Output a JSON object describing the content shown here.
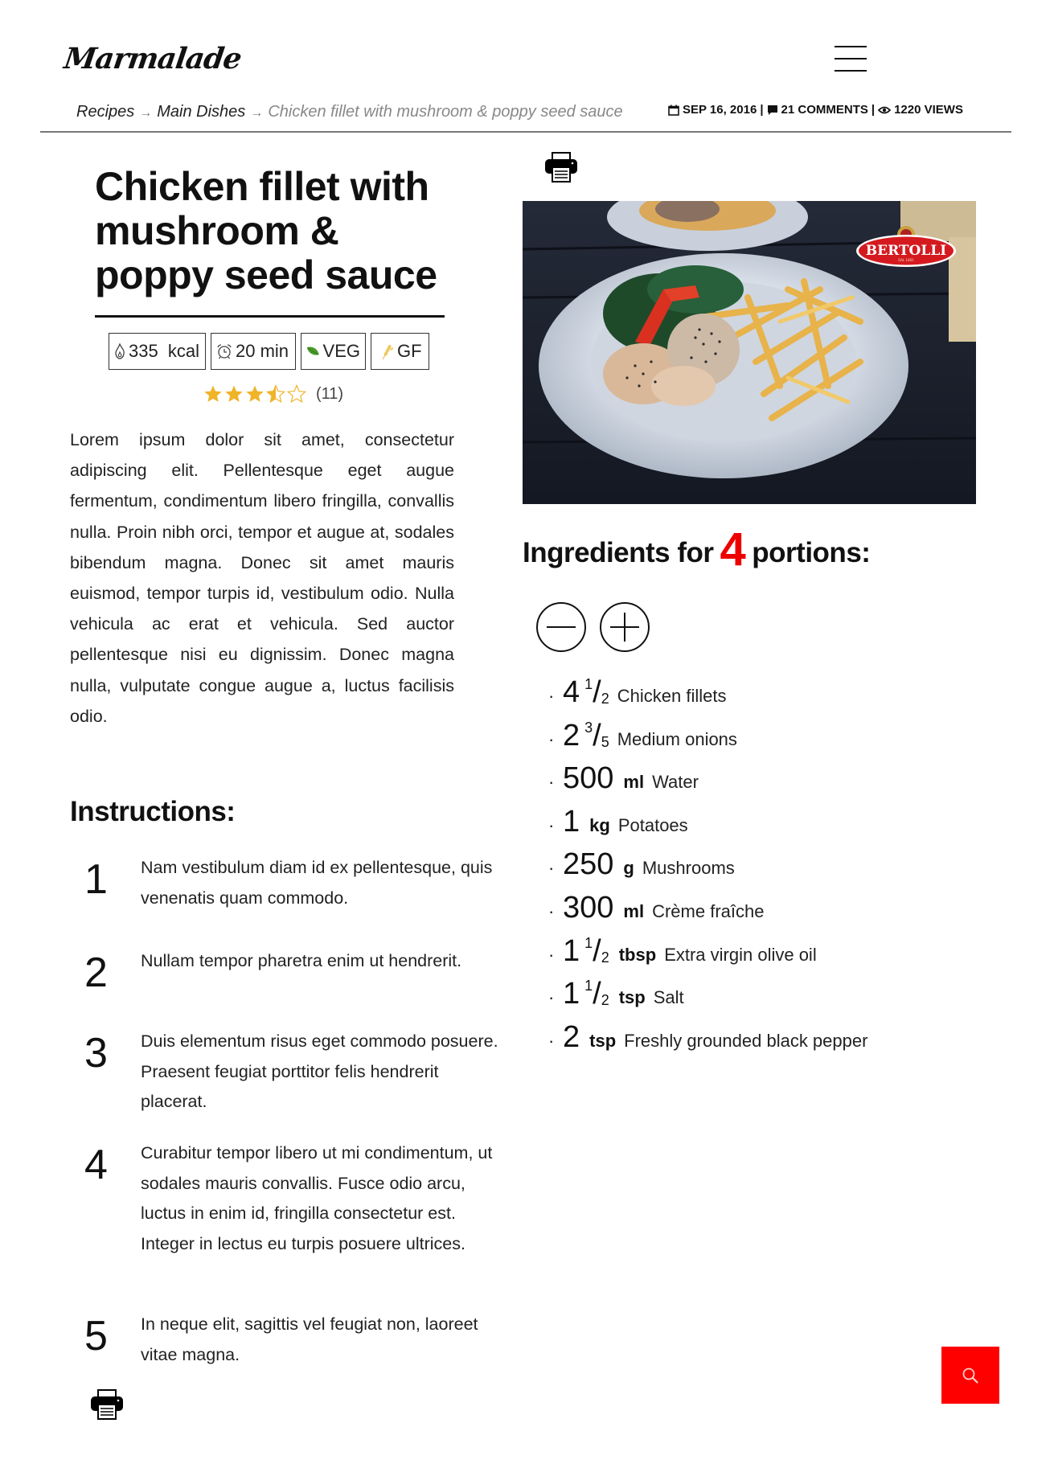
{
  "header": {
    "logo": "Marmalade",
    "menu_icon": "hamburger-menu-icon"
  },
  "breadcrumb": {
    "items": [
      "Recipes",
      "Main Dishes"
    ],
    "current": "Chicken fillet with mushroom & poppy seed sauce",
    "separator": "→"
  },
  "meta": {
    "date": "SEP 16, 2016",
    "comments": "21 COMMENTS",
    "views": "1220 VIEWS",
    "separator": "|"
  },
  "recipe": {
    "title": "Chicken fillet with mushroom & poppy seed sauce",
    "badges": [
      {
        "icon": "flame-icon",
        "label": "335  kcal"
      },
      {
        "icon": "alarm-clock-icon",
        "label": "20 min"
      },
      {
        "icon": "leaf-icon",
        "label": "VEG"
      },
      {
        "icon": "wheat-icon",
        "label": "GF"
      }
    ],
    "rating": {
      "value": 3.5,
      "max": 5,
      "count_label": "(11)"
    },
    "intro": "Lorem ipsum dolor sit amet, consectetur adipiscing elit. Pellentesque eget augue fermentum, condimentum libero fringilla, convallis nulla. Proin nibh orci, tempor et augue at, sodales bibendum magna. Donec sit amet mauris euismod, tempor turpis id, vestibulum odio. Nulla vehicula ac erat et vehicula. Sed auctor pellentesque nisi eu dignissim. Donec magna nulla, vulputate congue augue a, luctus facilisis odio.",
    "photo_logo": "BERTOLLI",
    "photo_logo_sub": "DAL 1865"
  },
  "ingredients": {
    "heading_prefix": "Ingredients for",
    "portions": "4",
    "heading_suffix": "portions:",
    "items": [
      {
        "qty": "4",
        "num": "1",
        "den": "2",
        "unit": "",
        "name": "Chicken fillets"
      },
      {
        "qty": "2",
        "num": "3",
        "den": "5",
        "unit": "",
        "name": "Medium onions"
      },
      {
        "qty": "500",
        "num": "",
        "den": "",
        "unit": "ml",
        "name": "Water"
      },
      {
        "qty": "1",
        "num": "",
        "den": "",
        "unit": "kg",
        "name": "Potatoes"
      },
      {
        "qty": "250",
        "num": "",
        "den": "",
        "unit": "g",
        "name": "Mushrooms"
      },
      {
        "qty": "300",
        "num": "",
        "den": "",
        "unit": "ml",
        "name": "Crème fraîche"
      },
      {
        "qty": "1",
        "num": "1",
        "den": "2",
        "unit": "tbsp",
        "name": "Extra virgin olive oil"
      },
      {
        "qty": "1",
        "num": "1",
        "den": "2",
        "unit": "tsp",
        "name": "Salt"
      },
      {
        "qty": "2",
        "num": "",
        "den": "",
        "unit": "tsp",
        "name": "Freshly grounded black pepper"
      }
    ]
  },
  "instructions": {
    "heading": "Instructions:",
    "steps": [
      {
        "num": "1",
        "text": "Nam vestibulum diam id ex pellentesque, quis venenatis quam commodo."
      },
      {
        "num": "2",
        "text": "Nullam tempor pharetra enim ut hendrerit."
      },
      {
        "num": "3",
        "text": "Duis elementum risus eget commodo posuere. Praesent feugiat porttitor felis hendrerit placerat."
      },
      {
        "num": "4",
        "text": "Curabitur tempor libero ut mi condimentum, ut sodales mauris convallis. Fusce odio arcu, luctus in enim id, fringilla consectetur est. Integer in lectus eu turpis posuere ultrices."
      },
      {
        "num": "5",
        "text": "In neque elit, sagittis vel feugiat non, laoreet vitae magna."
      }
    ]
  },
  "colors": {
    "accent": "#ff0000",
    "star": "#f0b429",
    "text": "#111111"
  }
}
